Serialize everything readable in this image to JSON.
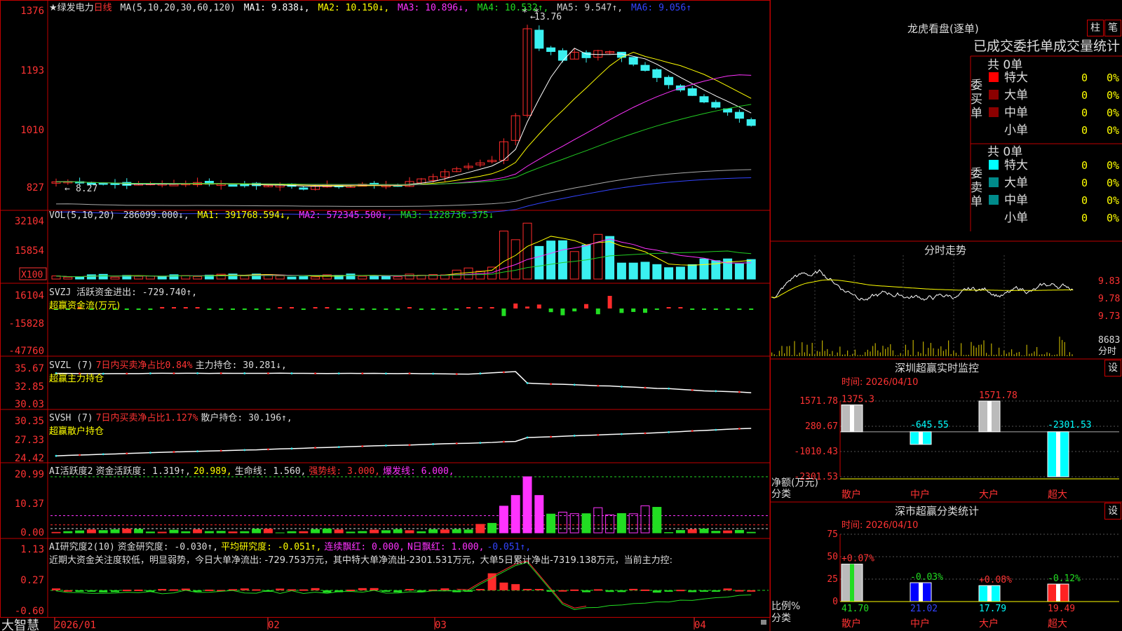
{
  "colors": {
    "up": "#ff2b2b",
    "down": "#3af0f0",
    "border": "#c00000",
    "ma1": "#ffffff",
    "ma2": "#ffff00",
    "ma3": "#ff33ff",
    "ma4": "#22cc22",
    "ma5": "#aaaaaa",
    "ma6": "#3344ff"
  },
  "price_panel": {
    "stock": "★绿发电力",
    "period": "日线",
    "ma_label": "MA(5,10,20,30,60,120)",
    "ma1": "MA1: 9.838↓,",
    "ma2": "MA2: 10.150↓,",
    "ma3": "MA3: 10.896↓,",
    "ma4": "MA4: 10.532↑,",
    "ma5": "MA5: 9.547↑,",
    "ma6": "MA6: 9.056↑",
    "yticks": [
      "1376",
      "1193",
      "1010",
      "827"
    ],
    "high_label": "13.76",
    "low_label": "8.27"
  },
  "vol_panel": {
    "title": "VOL(5,10,20)",
    "value": "286099.000↓,",
    "ma1": "MA1: 391768.594↓,",
    "ma2": "MA2: 572345.500↓,",
    "ma3": "MA3: 1228736.375↓",
    "yticks": [
      "32104",
      "15854"
    ],
    "unit": "X100"
  },
  "svzj_panel": {
    "title": "SVZJ  活跃资金进出: -729.740↑,",
    "sub": "超赢资金流(万元)",
    "yticks": [
      "16104",
      "-15828",
      "-47760"
    ]
  },
  "svzl_panel": {
    "title": "SVZL (7)",
    "t2": "7日内买卖净占比0.84%",
    "t3": "主力持仓: 30.281↓,",
    "sub": "超赢主力持仓",
    "yticks": [
      "35.67",
      "32.85",
      "30.03"
    ]
  },
  "svsh_panel": {
    "title": "SVSH (7)",
    "t2": "7日内买卖净占比1.127%",
    "t3": "散户持仓: 30.196↑,",
    "sub": "超赢散户持仓",
    "yticks": [
      "30.35",
      "27.33",
      "24.42"
    ]
  },
  "ai1_panel": {
    "title": "AI活跃度2",
    "t2": "资金活跃度: 1.319↑,",
    "t3": "20.989,",
    "t4": "生命线: 1.560,",
    "t5": "强势线: 3.000,",
    "t6": "爆发线: 6.000,",
    "yticks": [
      "20.99",
      "10.37",
      "0.00"
    ]
  },
  "ai2_panel": {
    "title": "AI研究度2(10)",
    "t2": "资金研究度: -0.030↑,",
    "t3": "平均研究度: -0.051↑,",
    "t4": "连续飘红: 0.000,",
    "t5": "N日飘红: 1.000,",
    "t6": "-0.051↑,",
    "desc": "近期大资金关注度较低，明显弱势，今日大单净流出: -729.753万元，其中特大单净流出-2301.531万元，大单5日累计净出-7319.138万元，当前主力控:",
    "yticks": [
      "1.13",
      "0.27",
      "-0.60"
    ]
  },
  "date_axis": {
    "brand": "大智慧",
    "labels": [
      "2026/01",
      "02",
      "03",
      "04"
    ]
  },
  "longhu": {
    "title": "龙虎看盘(逐单)",
    "btn1": "柱",
    "btn2": "笔",
    "header": "已成交委托单成交量统计",
    "buy_label": "委买单",
    "buy_total": "共 0单",
    "sell_label": "委卖单",
    "sell_total": "共 0单",
    "rows": [
      {
        "name": "特大",
        "val": "0",
        "pct": "0%"
      },
      {
        "name": "大单",
        "val": "0",
        "pct": "0%"
      },
      {
        "name": "中单",
        "val": "0",
        "pct": "0%"
      },
      {
        "name": "小单",
        "val": "0",
        "pct": "0%"
      }
    ]
  },
  "fenshi": {
    "title": "分时走势",
    "prices": [
      "9.83",
      "9.78",
      "9.73"
    ],
    "vol": "8683",
    "vol_label": "分时"
  },
  "monitor": {
    "title": "深圳超赢实时监控",
    "btn": "设",
    "time": "时间: 2026/04/10",
    "yticks": [
      "1571.78",
      "280.67",
      "-1010.43",
      "-2301.53"
    ],
    "bars": [
      {
        "cat": "散户",
        "label": "1375.3",
        "value": 1375.3
      },
      {
        "cat": "中户",
        "label": "-645.55",
        "value": -645.55
      },
      {
        "cat": "大户",
        "label": "1571.78",
        "value": 1571.78
      },
      {
        "cat": "超大",
        "label": "-2301.53",
        "value": -2301.53
      }
    ],
    "ylabel": "净额(万元)",
    "xlabel": "分类"
  },
  "classify": {
    "title": "深市超赢分类统计",
    "btn": "设",
    "time": "时间: 2026/04/10",
    "yticks": [
      "75",
      "50",
      "25",
      "0"
    ],
    "bars": [
      {
        "cat": "散户",
        "top": "+0.07%",
        "value": 41.7,
        "bottom": "41.70"
      },
      {
        "cat": "中户",
        "top": "-0.03%",
        "value": 21.02,
        "bottom": "21.02"
      },
      {
        "cat": "大户",
        "top": "+0.08%",
        "value": 17.79,
        "bottom": "17.79"
      },
      {
        "cat": "超大",
        "top": "-0.12%",
        "value": 19.49,
        "bottom": "19.49"
      }
    ],
    "ylabel": "比例%",
    "xlabel": "分类"
  }
}
